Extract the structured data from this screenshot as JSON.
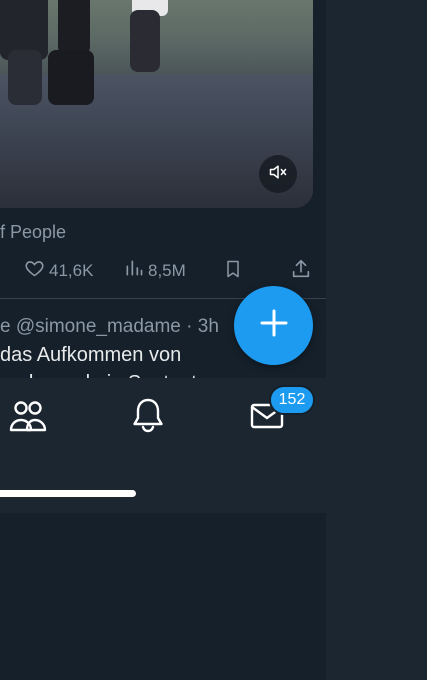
{
  "post": {
    "source_text": "f People",
    "likes": "41,6K",
    "views": "8,5M"
  },
  "next_tweet": {
    "header": "e @simone_madame · 3h",
    "line1": "das Aufkommen von",
    "line2": "ender und ein Saatgut..."
  },
  "nav": {
    "messages_badge": "152"
  },
  "icons": {
    "mute": "speaker-muted-icon",
    "like": "heart-icon",
    "views": "bar-chart-icon",
    "bookmark": "bookmark-icon",
    "share": "share-icon",
    "compose": "plus-icon",
    "communities": "people-icon",
    "notifications": "bell-icon",
    "messages": "envelope-icon"
  },
  "colors": {
    "background": "#15202b",
    "accent": "#1d9bf0",
    "muted_text": "#8b98a5",
    "text": "#e7e9ea"
  }
}
